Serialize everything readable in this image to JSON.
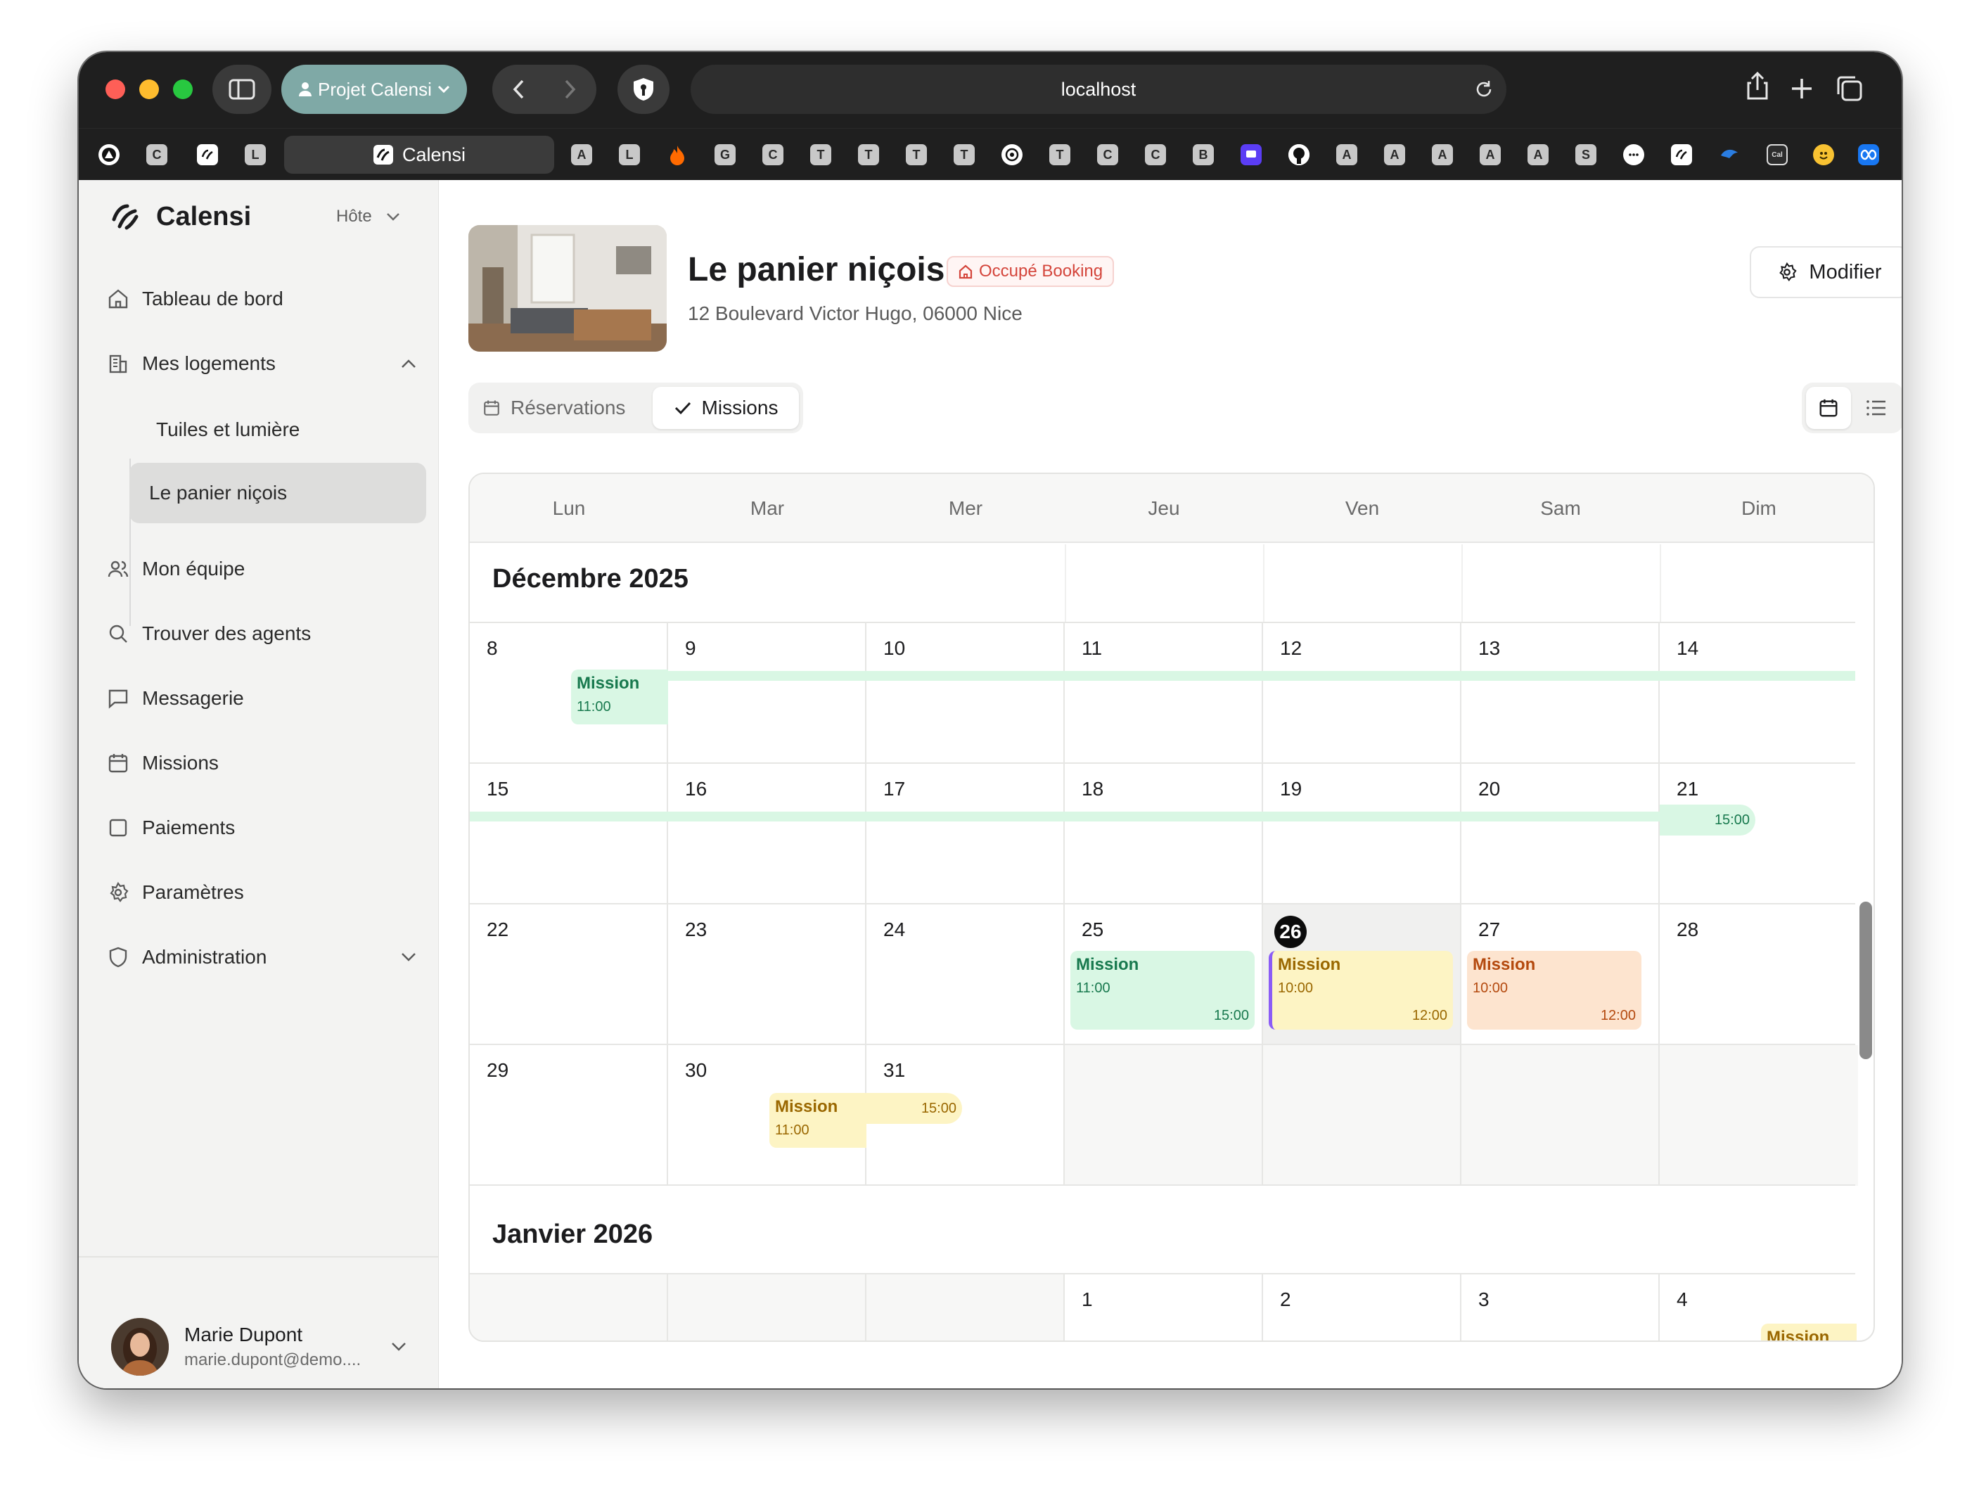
{
  "browser": {
    "profile_label": "Projet Calensi",
    "url": "localhost",
    "active_tab_label": "Calensi",
    "favorites": [
      "C",
      "L",
      "A",
      "L",
      "G",
      "C",
      "T",
      "T",
      "T",
      "T",
      "T",
      "C",
      "C",
      "B",
      "A",
      "A",
      "A",
      "A",
      "A",
      "S"
    ]
  },
  "sidebar": {
    "brand": "Calensi",
    "role_select": "Hôte",
    "nav": {
      "dashboard": "Tableau de bord",
      "my_listings": "Mes logements",
      "listing_1": "Tuiles et lumière",
      "listing_2": "Le panier niçois",
      "team": "Mon équipe",
      "find_agents": "Trouver des agents",
      "messages": "Messagerie",
      "missions": "Missions",
      "payments": "Paiements",
      "settings": "Paramètres",
      "admin": "Administration"
    },
    "user": {
      "name": "Marie Dupont",
      "email": "marie.dupont@demo...."
    }
  },
  "property": {
    "title": "Le panier niçois",
    "status_badge": "Occupé Booking",
    "address": "12 Boulevard Victor Hugo, 06000 Nice",
    "edit_button": "Modifier"
  },
  "tabs": {
    "reservations": "Réservations",
    "missions": "Missions"
  },
  "calendar": {
    "weekdays": [
      "Lun",
      "Mar",
      "Mer",
      "Jeu",
      "Ven",
      "Sam",
      "Dim"
    ],
    "months": {
      "dec": "Décembre 2025",
      "jan": "Janvier 2026"
    },
    "days": {
      "w1": [
        "8",
        "9",
        "10",
        "11",
        "12",
        "13",
        "14"
      ],
      "w2": [
        "15",
        "16",
        "17",
        "18",
        "19",
        "20",
        "21"
      ],
      "w3": [
        "22",
        "23",
        "24",
        "25",
        "26",
        "27",
        "28"
      ],
      "w4": [
        "29",
        "30",
        "31"
      ],
      "w5": [
        "1",
        "2",
        "3",
        "4"
      ]
    },
    "events": {
      "e1": {
        "title": "Mission",
        "start": "11:00"
      },
      "e2": {
        "end": "15:00"
      },
      "e3": {
        "title": "Mission",
        "start": "11:00",
        "end": "15:00"
      },
      "e4": {
        "title": "Mission",
        "start": "10:00",
        "end": "12:00"
      },
      "e5": {
        "title": "Mission",
        "start": "10:00",
        "end": "12:00"
      },
      "e6": {
        "title": "Mission",
        "start": "11:00",
        "end": "15:00"
      },
      "e7": {
        "title": "Mission"
      }
    }
  },
  "colors": {
    "green_event": "#d9f7e4",
    "yellow_event": "#fdf4c4",
    "orange_event": "#fde4cf",
    "today_marker": "#0c0c0c",
    "purple_accent": "#8b5cf6",
    "occupied_red": "#d4453b"
  }
}
